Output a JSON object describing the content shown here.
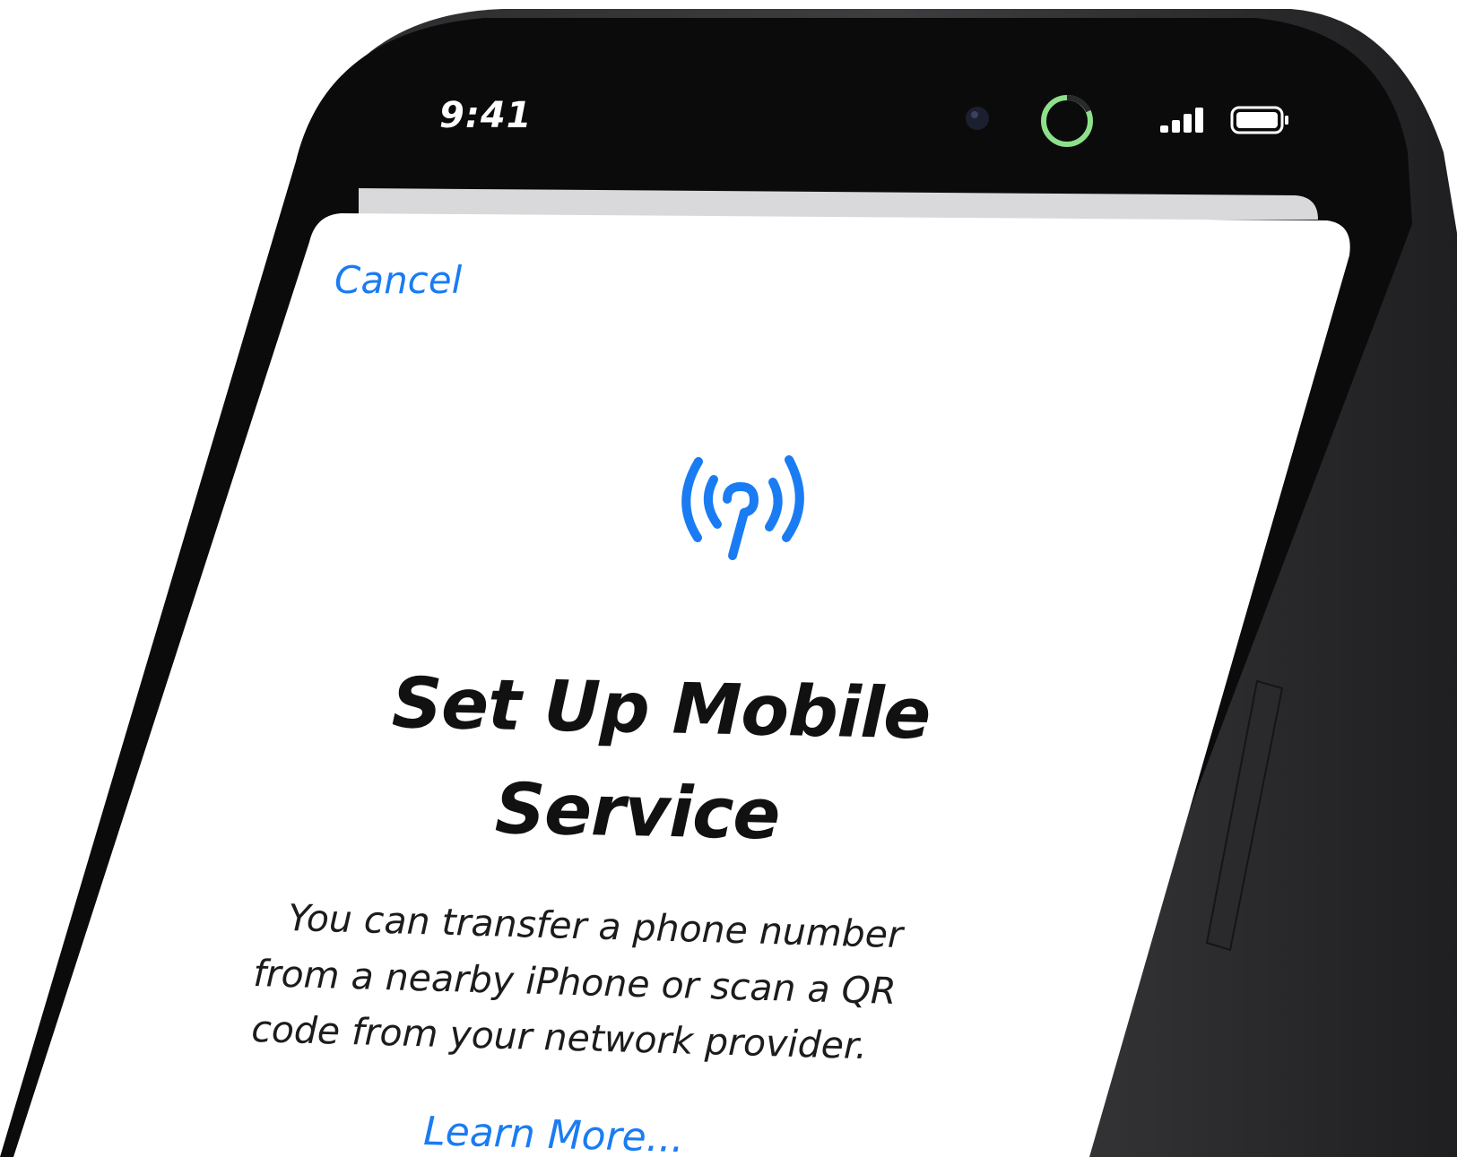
{
  "status_bar": {
    "time": "9:41"
  },
  "sheet": {
    "cancel_label": "Cancel",
    "icon": "antenna-radiowaves-icon",
    "title_line1": "Set Up Mobile",
    "title_line2": "Service",
    "body_line1": "You can transfer a phone number",
    "body_line2": "from a nearby iPhone or scan a QR",
    "body_line3": "code from your network provider.",
    "learn_more_label": "Learn More..."
  },
  "colors": {
    "accent": "#1a7cf3",
    "frame": "#1b1b1c",
    "screen_bg": "#ffffff",
    "text": "#111111",
    "activity_ring": "#8ee08a"
  }
}
